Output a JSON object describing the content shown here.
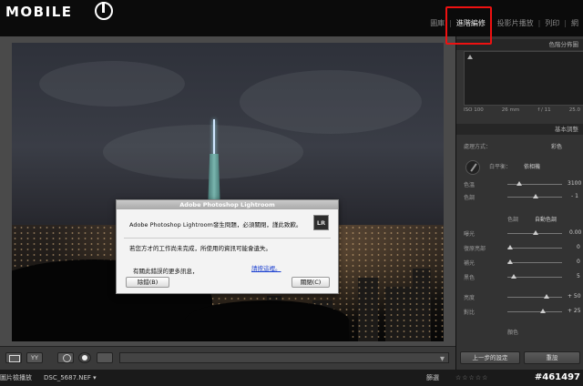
{
  "logo": {
    "text": "MOBILE"
  },
  "modules": [
    {
      "label": "圖庫",
      "active": false
    },
    {
      "label": "進階編修",
      "active": true
    },
    {
      "label": "投影片播放",
      "active": false
    },
    {
      "label": "列印",
      "active": false
    },
    {
      "label": "網",
      "active": false
    }
  ],
  "dialog": {
    "title": "Adobe Photoshop Lightroom",
    "message": "Adobe Photoshop Lightroom發生問題，必須關閉，謹此致歉。",
    "icon_label": "LR",
    "message2": "若您方才的工作尚未完成，所使用的資訊可能會遺失。",
    "more_info": "有關此錯誤的更多訊息，",
    "link": "請按這裡。",
    "debug_button": "除錯(B)",
    "close_button": "關閉(C)"
  },
  "toolbar": {
    "yy_label": "YY"
  },
  "status": {
    "left_label": "圖片檢播放",
    "filename": "DSC_5687.NEF",
    "filter_label": "篩選",
    "stars": "☆☆☆☆☆",
    "watermark": "#461497"
  },
  "right_panel": {
    "histogram_header": "色階分佈圖",
    "hist_info": [
      "ISO 100",
      "26 mm",
      "f / 11",
      "25.0"
    ],
    "basic_header": "基本調整",
    "treatment_label": "處理方式：",
    "treatment_value": "彩色",
    "wb_label": "白平衡：",
    "wb_value": "依相機",
    "temp_label": "色溫",
    "temp_value": "3100",
    "tint_label": "色調",
    "tint_value": "- 1",
    "tone_label": "色調",
    "auto_label": "自動色調",
    "exposure_label": "曝光",
    "exposure_value": "0.00",
    "recovery_label": "復原亮部",
    "recovery_value": "0",
    "fill_label": "補光",
    "fill_value": "0",
    "blacks_label": "黑色",
    "blacks_value": "5",
    "brightness_label": "亮度",
    "brightness_value": "+ 50",
    "contrast_label": "對比",
    "contrast_value": "+ 25",
    "presence_label": "顏色",
    "prev_button": "上一步的設定",
    "reset_button": "重設"
  }
}
